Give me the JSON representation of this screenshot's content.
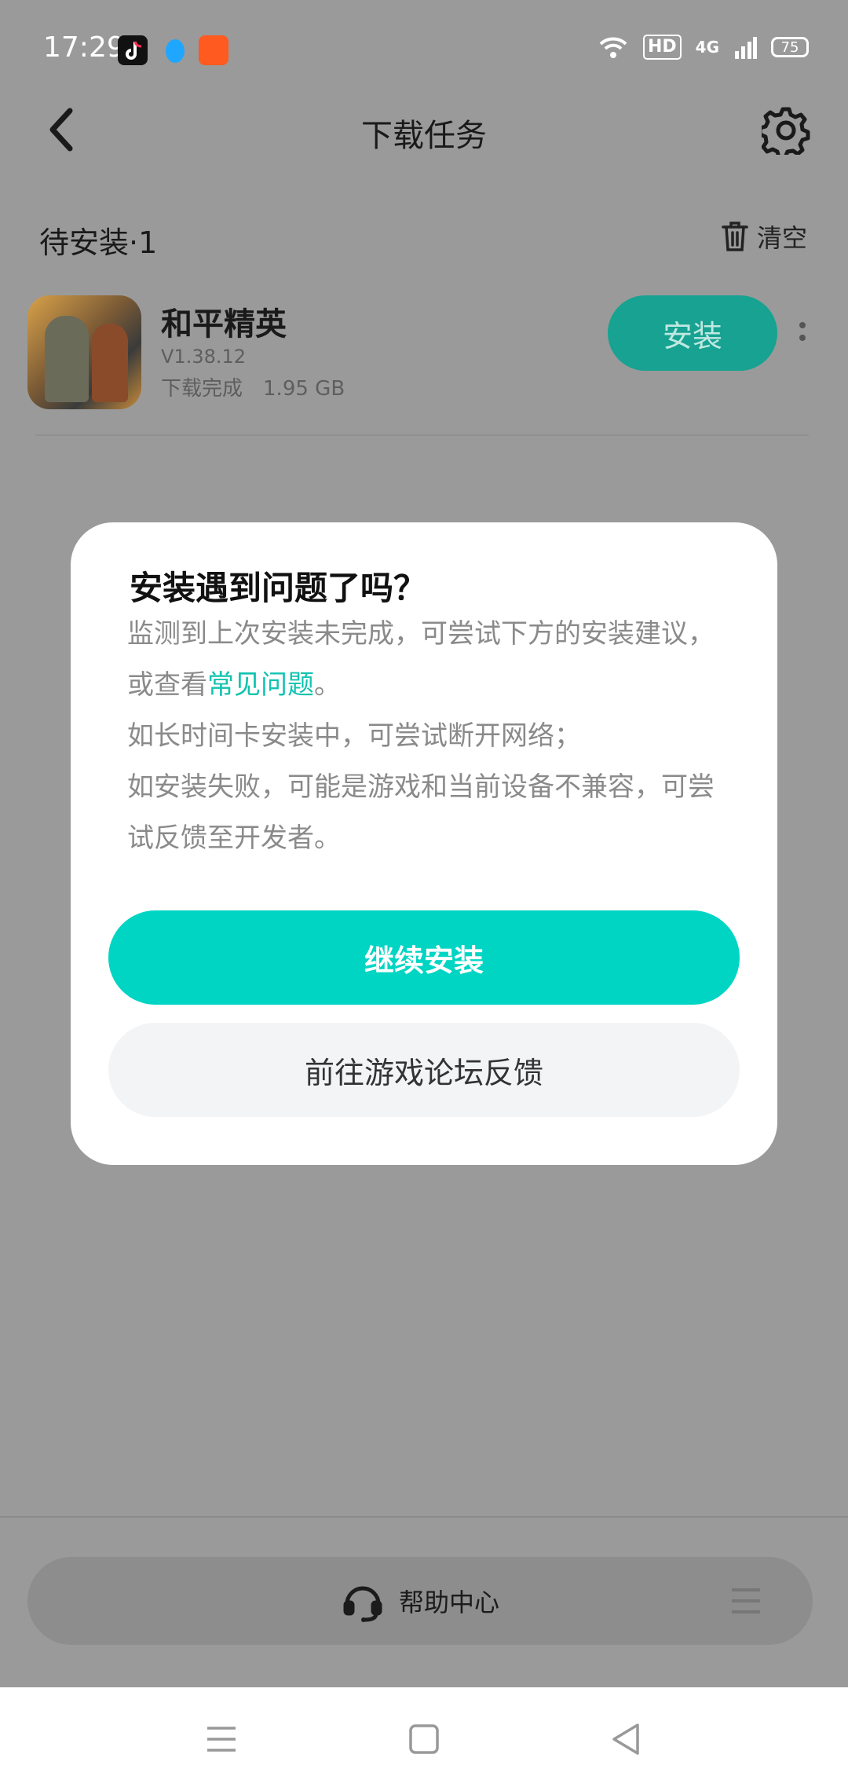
{
  "status_bar": {
    "time": "17:29",
    "hd": "HD",
    "network": "4G",
    "battery": "75",
    "apps": [
      {
        "icon": "tiktok-icon",
        "color": "#111111"
      },
      {
        "icon": "qq-icon",
        "color": "#1fa7ff"
      },
      {
        "icon": "kuaishou-icon",
        "color": "#ff5a1f"
      }
    ]
  },
  "header": {
    "title": "下载任务",
    "back_icon": "chevron-left-icon",
    "settings_icon": "gear-icon"
  },
  "pending": {
    "title": "待安装·1",
    "clear_label": "清空"
  },
  "app_item": {
    "name": "和平精英",
    "version": "V1.38.12",
    "status": "下载完成",
    "size": "1.95 GB",
    "install_label": "安装"
  },
  "dialog": {
    "title": "安装遇到问题了吗？",
    "body_part1": "监测到上次安装未完成，可尝试下方的安装建议，或查看",
    "link_text": "常见问题",
    "body_part1_end": "。",
    "body_part2": "如长时间卡安装中，可尝试断开网络；",
    "body_part3": "如安装失败，可能是游戏和当前设备不兼容，可尝试反馈至开发者。",
    "continue_label": "继续安装",
    "forum_label": "前往游戏论坛反馈"
  },
  "help": {
    "label": "帮助中心"
  },
  "colors": {
    "accent": "#00d5c4",
    "install_bg": "#17a291",
    "link": "#11c3b0"
  }
}
